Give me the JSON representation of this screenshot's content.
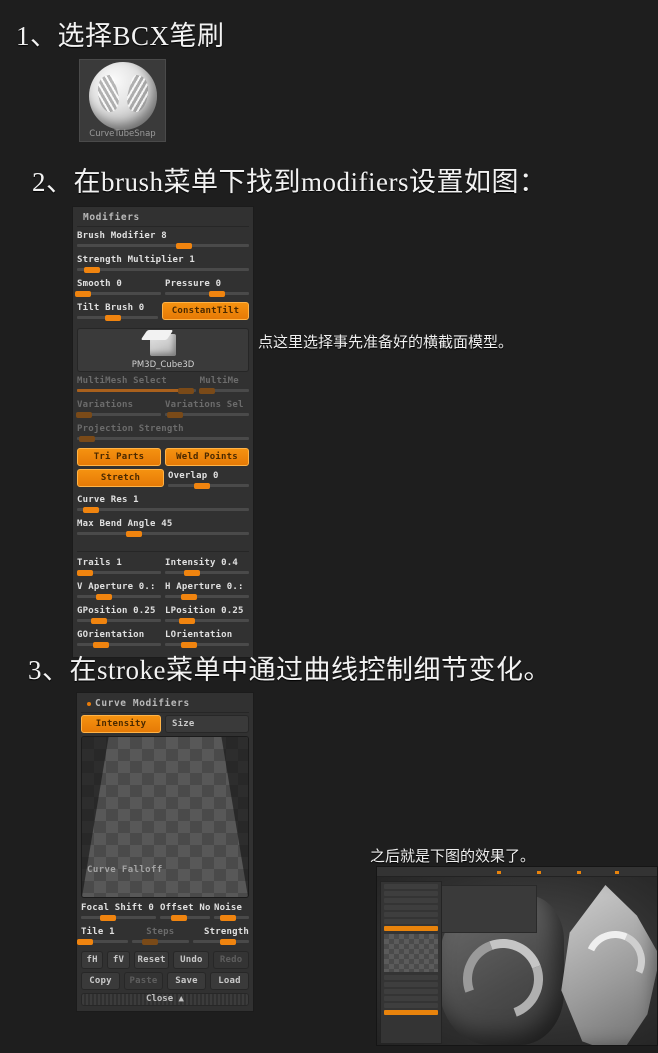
{
  "steps": {
    "step1_heading": "1、选择BCX笔刷",
    "step2_heading": "2、在brush菜单下找到modifiers设置如图：",
    "step3_heading": "3、在stroke菜单中通过曲线控制细节变化。"
  },
  "notes": {
    "cube_note": "点这里选择事先准备好的横截面模型。",
    "result_note": "之后就是下图的效果了。"
  },
  "brush": {
    "label": "CurveTubeSnap"
  },
  "modifiers_panel": {
    "title": "Modifiers",
    "sliders": [
      {
        "label": "Brush Modifier 8",
        "knob": 62,
        "fill": 0,
        "dim": false
      },
      {
        "label": "Strength Multiplier 1",
        "knob": 9,
        "fill": 0,
        "dim": false
      },
      {
        "label": "Smooth 0",
        "knob": 7,
        "fill": 0,
        "dim": false
      },
      {
        "label": "Pressure 0",
        "knob": 62,
        "fill": 0,
        "dim": false
      },
      {
        "label": "Tilt Brush 0",
        "knob": 44,
        "fill": 0,
        "dim": false
      },
      {
        "label": "MultiMesh Select",
        "knob": 92,
        "fill": 92,
        "dim": true
      },
      {
        "label": "MultiMe",
        "knob": 12,
        "fill": 0,
        "dim": true
      },
      {
        "label": "Variations",
        "knob": 7,
        "fill": 0,
        "dim": true
      },
      {
        "label": "Variations Sel",
        "knob": 12,
        "fill": 0,
        "dim": true
      },
      {
        "label": "Projection Strength",
        "knob": 6,
        "fill": 0,
        "dim": true
      },
      {
        "label": "Overlap 0",
        "knob": 42,
        "fill": 0,
        "dim": false
      },
      {
        "label": "Curve Res 1",
        "knob": 8,
        "fill": 0,
        "dim": false
      },
      {
        "label": "Max Bend Angle 45",
        "knob": 33,
        "fill": 0,
        "dim": false
      },
      {
        "label": "Trails 1",
        "knob": 10,
        "fill": 0,
        "dim": false
      },
      {
        "label": "Intensity 0.4",
        "knob": 32,
        "fill": 0,
        "dim": false
      },
      {
        "label": "V Aperture 0.:",
        "knob": 32,
        "fill": 0,
        "dim": false
      },
      {
        "label": "H Aperture 0.:",
        "knob": 28,
        "fill": 0,
        "dim": false
      },
      {
        "label": "GPosition 0.25",
        "knob": 26,
        "fill": 0,
        "dim": false
      },
      {
        "label": "LPosition 0.25",
        "knob": 26,
        "fill": 0,
        "dim": false
      },
      {
        "label": "GOrientation",
        "knob": 28,
        "fill": 0,
        "dim": false
      },
      {
        "label": "LOrientation",
        "knob": 28,
        "fill": 0,
        "dim": false
      }
    ],
    "constant_tilt_button": "ConstantTilt",
    "mesh_label": "PM3D_Cube3D",
    "tri_parts_button": "Tri Parts",
    "weld_points_button": "Weld Points",
    "stretch_button": "Stretch"
  },
  "curve_panel": {
    "title": "Curve Modifiers",
    "tab_intensity": "Intensity",
    "tab_size": "Size",
    "graph_label": "Curve Falloff",
    "sliders": [
      {
        "label": "Focal Shift 0",
        "knob": 36,
        "dim": false
      },
      {
        "label": "Offset Noise",
        "knob": 38,
        "dim": false
      },
      {
        "label": "Noise",
        "knob": 40,
        "dim": false
      },
      {
        "label": "Tile 1",
        "knob": 8,
        "dim": false
      },
      {
        "label": "Steps",
        "knob": 32,
        "dim": true
      },
      {
        "label": "Strength",
        "knob": 40,
        "dim": false
      }
    ],
    "buttons_row1": [
      {
        "label": "fH",
        "state": "off"
      },
      {
        "label": "fV",
        "state": "off"
      },
      {
        "label": "Reset",
        "state": "off"
      },
      {
        "label": "Undo",
        "state": "off"
      },
      {
        "label": "Redo",
        "state": "dis"
      }
    ],
    "buttons_row2": [
      {
        "label": "Copy",
        "state": "off"
      },
      {
        "label": "Paste",
        "state": "dis"
      },
      {
        "label": "Save",
        "state": "off"
      },
      {
        "label": "Load",
        "state": "off"
      }
    ],
    "close_label": "Close ▲"
  },
  "colors": {
    "accent": "#f0840f",
    "panel_bg": "#313131",
    "page_bg": "#1e1e1e",
    "text": "#e0e0e0"
  }
}
